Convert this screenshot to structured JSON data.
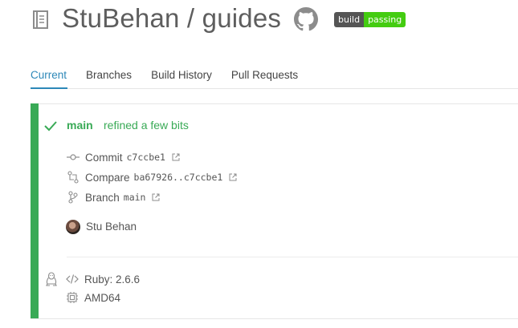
{
  "repo": {
    "owner": "StuBehan",
    "separator": "/",
    "name": "guides",
    "title": "StuBehan / guides"
  },
  "badge": {
    "label": "build",
    "status": "passing",
    "label_color": "#555555",
    "status_color": "#44cc11"
  },
  "tabs": [
    {
      "label": "Current",
      "active": true
    },
    {
      "label": "Branches",
      "active": false
    },
    {
      "label": "Build History",
      "active": false
    },
    {
      "label": "Pull Requests",
      "active": false
    }
  ],
  "build": {
    "state": "passed",
    "state_color": "#39aa56",
    "branch": "main",
    "message": "refined a few bits",
    "commit": {
      "label": "Commit",
      "value": "c7ccbe1"
    },
    "compare": {
      "label": "Compare",
      "value": "ba67926..c7ccbe1"
    },
    "branch_link": {
      "label": "Branch",
      "value": "main"
    },
    "author": "Stu Behan",
    "language": "Ruby: 2.6.6",
    "arch": "AMD64",
    "os_icon": "linux-icon"
  },
  "accent": "#2d88b8"
}
